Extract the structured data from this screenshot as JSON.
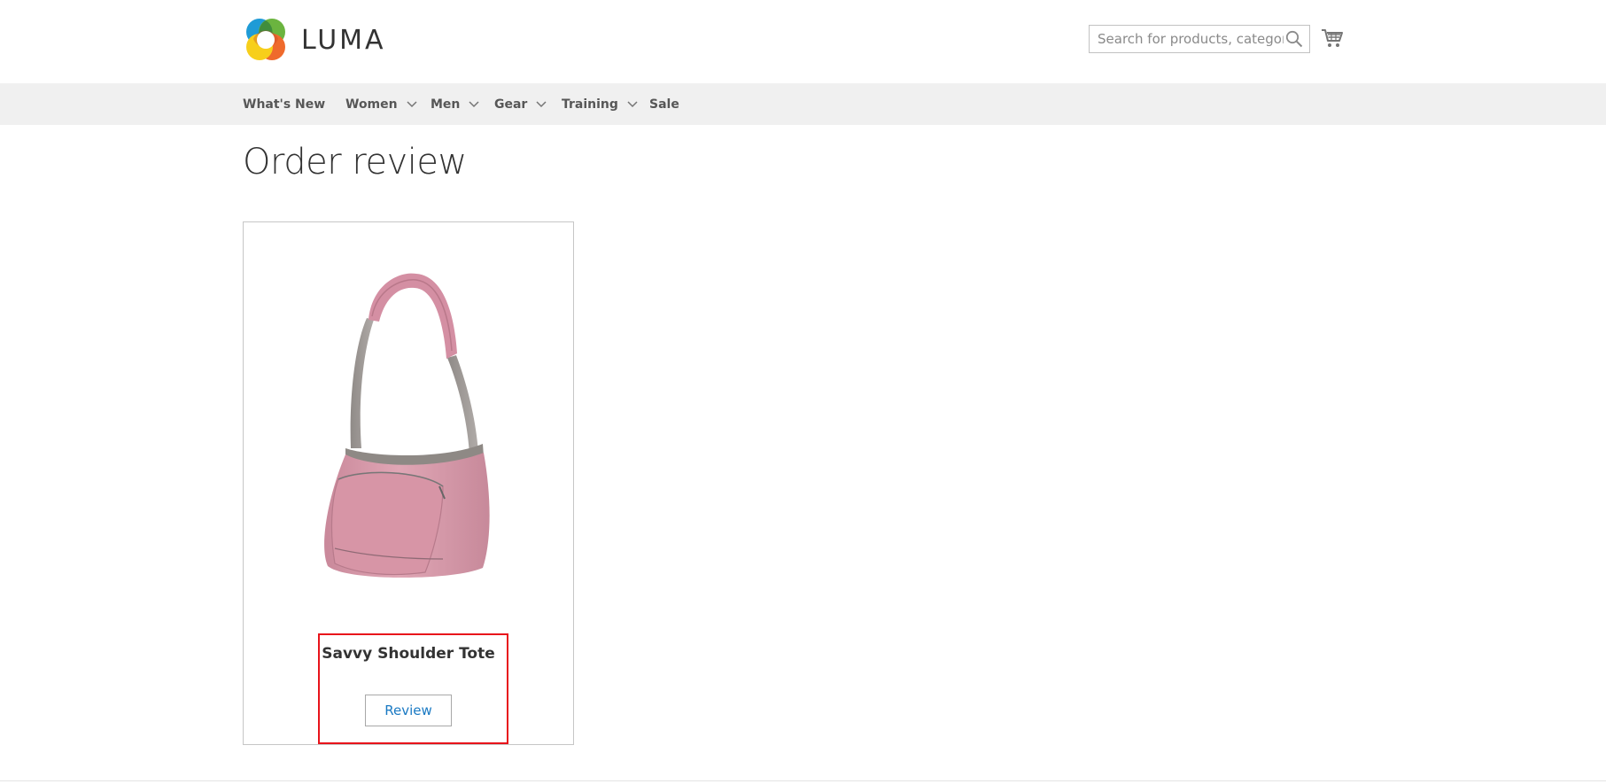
{
  "header": {
    "logo_text": "LUMA",
    "search": {
      "placeholder": "Search for products, categories, ..."
    },
    "icons": {
      "search": "search-icon",
      "cart": "shopping-cart-icon",
      "logo": "luma-logo-icon"
    }
  },
  "nav": {
    "items": [
      {
        "label": "What's New",
        "has_dropdown": false
      },
      {
        "label": "Women",
        "has_dropdown": true
      },
      {
        "label": "Men",
        "has_dropdown": true
      },
      {
        "label": "Gear",
        "has_dropdown": true
      },
      {
        "label": "Training",
        "has_dropdown": true
      },
      {
        "label": "Sale",
        "has_dropdown": false
      }
    ]
  },
  "main": {
    "title": "Order review",
    "product": {
      "name": "Savvy Shoulder Tote",
      "action_label": "Review"
    }
  },
  "colors": {
    "nav_background": "#f0f0f0",
    "link_blue": "#1979c3",
    "highlight_red": "#e8141b",
    "bag_pink": "#d99aa8",
    "strap_gray": "#9a9693"
  }
}
